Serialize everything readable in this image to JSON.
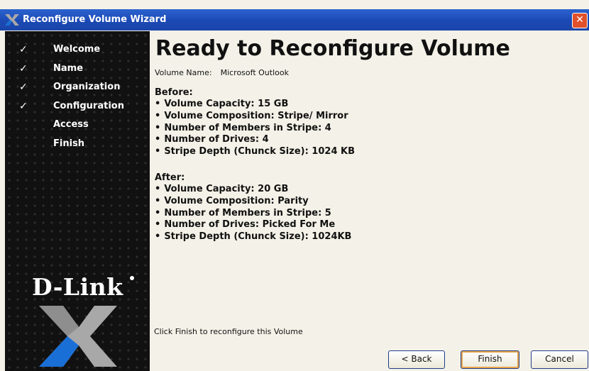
{
  "window": {
    "title": "Reconfigure Volume Wizard",
    "close_icon": "close-icon"
  },
  "sidebar": {
    "steps": [
      {
        "label": "Welcome",
        "done": true,
        "check": "✓"
      },
      {
        "label": "Name",
        "done": true,
        "check": "✓"
      },
      {
        "label": "Organization",
        "done": true,
        "check": "✓"
      },
      {
        "label": "Configuration",
        "done": true,
        "check": "✓"
      },
      {
        "label": "Access",
        "done": false,
        "check": ""
      },
      {
        "label": "Finish",
        "done": false,
        "check": ""
      }
    ],
    "brand": "D-Link",
    "brand_icon": "dlink-x-logo-icon"
  },
  "main": {
    "heading": "Ready to Reconfigure Volume",
    "volume_name_label": "Volume Name:",
    "volume_name_value": "Microsoft Outlook",
    "before": {
      "title": "Before:",
      "items": [
        "Volume Capacity: 15 GB",
        "Volume Composition: Stripe/ Mirror",
        "Number of Members in Stripe: 4",
        "Number of Drives: 4",
        "Stripe Depth (Chunck Size): 1024 KB"
      ]
    },
    "after": {
      "title": "After:",
      "items": [
        "Volume Capacity: 20 GB",
        "Volume Composition: Parity",
        "Number of Members in Stripe: 5",
        "Number of Drives: Picked For Me",
        "Stripe Depth (Chunck Size): 1024KB"
      ]
    },
    "footer_text": "Click Finish to reconfigure this Volume"
  },
  "buttons": {
    "back": "< Back",
    "finish": "Finish",
    "cancel": "Cancel"
  },
  "colors": {
    "titlebar": "#1b49b4",
    "sidebar_bg": "#111111",
    "logo_blue": "#1a6fd6",
    "logo_gray": "#a8a8a8"
  }
}
